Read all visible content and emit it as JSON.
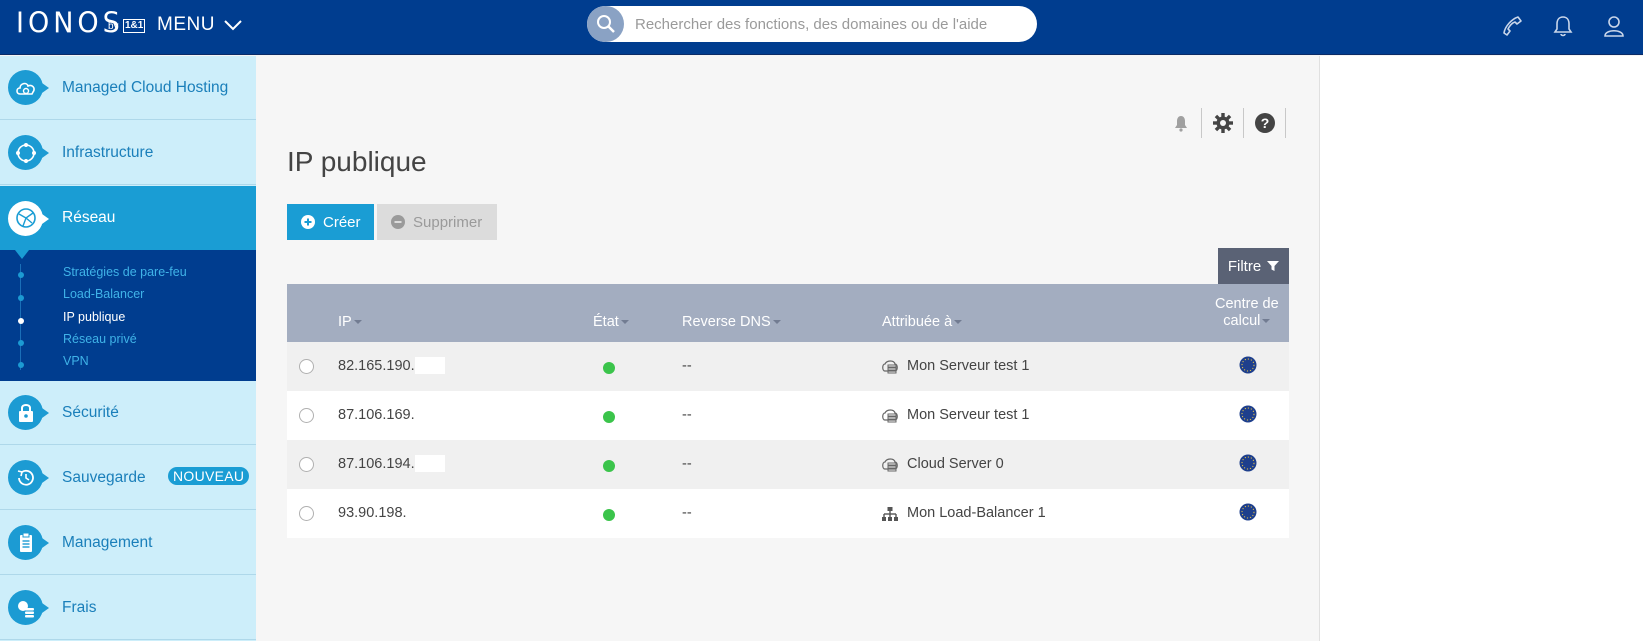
{
  "header": {
    "logo": "IONOS",
    "logo_by": "by",
    "logo_brand": "1&1",
    "menu_label": "MENU",
    "search_placeholder": "Rechercher des fonctions, des domaines ou de l'aide"
  },
  "sidebar": {
    "items": [
      {
        "label": "Managed Cloud Hosting",
        "icon": "cloud-icon"
      },
      {
        "label": "Infrastructure",
        "icon": "infrastructure-icon"
      },
      {
        "label": "Réseau",
        "icon": "network-globe-icon"
      },
      {
        "label": "Sécurité",
        "icon": "lock-icon"
      },
      {
        "label": "Sauvegarde",
        "icon": "backup-clock-icon",
        "badge": "NOUVEAU"
      },
      {
        "label": "Management",
        "icon": "clipboard-icon"
      },
      {
        "label": "Frais",
        "icon": "coins-icon"
      }
    ],
    "subitems": [
      {
        "label": "Stratégies de pare-feu"
      },
      {
        "label": "Load-Balancer"
      },
      {
        "label": "IP publique"
      },
      {
        "label": "Réseau privé"
      },
      {
        "label": "VPN"
      }
    ]
  },
  "main": {
    "title": "IP publique",
    "create_label": "Créer",
    "delete_label": "Supprimer",
    "filter_label": "Filtre"
  },
  "table": {
    "columns": {
      "ip": "IP",
      "state": "État",
      "reverse_dns": "Reverse DNS",
      "assigned": "Attribuée à",
      "datacenter_line1": "Centre de",
      "datacenter_line2": "calcul"
    },
    "rows": [
      {
        "ip": "82.165.190.",
        "state": "active",
        "reverse_dns": "--",
        "assigned": "Mon Serveur test 1",
        "assigned_icon": "server-icon"
      },
      {
        "ip": "87.106.169.",
        "state": "active",
        "reverse_dns": "--",
        "assigned": "Mon Serveur test 1",
        "assigned_icon": "server-icon"
      },
      {
        "ip": "87.106.194.",
        "state": "active",
        "reverse_dns": "--",
        "assigned": "Cloud Server 0",
        "assigned_icon": "server-icon"
      },
      {
        "ip": "93.90.198.",
        "state": "active",
        "reverse_dns": "--",
        "assigned": "Mon Load-Balancer 1",
        "assigned_icon": "load-balancer-icon"
      }
    ]
  },
  "colors": {
    "header_bg": "#003d8f",
    "accent": "#1a9dd4",
    "sidebar_bg": "#cdeefa",
    "status_green": "#3bc44b",
    "table_header": "#a3adc0"
  }
}
